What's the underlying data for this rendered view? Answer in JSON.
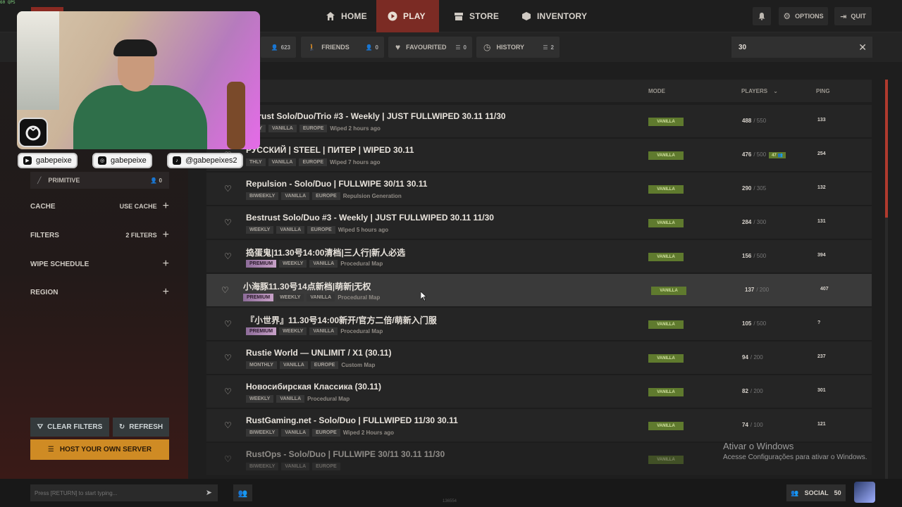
{
  "fps": "60 QPS",
  "nav": {
    "home": "HOME",
    "play": "PLAY",
    "store": "STORE",
    "inventory": "INVENTORY",
    "options": "OPTIONS",
    "quit": "QUIT"
  },
  "filter_tabs": [
    {
      "label": "",
      "count": "623"
    },
    {
      "label": "FRIENDS",
      "count": "0"
    },
    {
      "label": "FAVOURITED",
      "count": "0"
    },
    {
      "label": "HISTORY",
      "count": "2"
    }
  ],
  "search": {
    "value": "30"
  },
  "sidebar": {
    "primitive": {
      "label": "PRIMITIVE",
      "count": "0"
    },
    "cache": {
      "label": "CACHE",
      "action": "USE CACHE"
    },
    "filters": {
      "label": "FILTERS",
      "action": "2 FILTERS"
    },
    "wipe_schedule": {
      "label": "WIPE SCHEDULE"
    },
    "region": {
      "label": "REGION"
    },
    "clear_filters": "CLEAR FILTERS",
    "refresh": "REFRESH",
    "host_server": "HOST YOUR OWN SERVER"
  },
  "list_headers": {
    "name": "E",
    "mode": "MODE",
    "players": "PLAYERS",
    "ping": "PING"
  },
  "servers": [
    {
      "name": "estrust Solo/Duo/Trio #3 - Weekly | JUST FULLWIPED 30.11 11/30",
      "tags": [
        "EKLY",
        "VANILLA",
        "EUROPE"
      ],
      "desc": "Wiped 2 hours ago",
      "mode": "VANILLA",
      "players": "488",
      "max": "/ 550",
      "queue": "",
      "ping": "133"
    },
    {
      "name": "РУССКИЙ | STEEL | ПИТЕР | WIPED 30.11",
      "tags": [
        "THLY",
        "VANILLA",
        "EUROPE"
      ],
      "desc": "Wiped 7 hours ago",
      "mode": "VANILLA",
      "players": "476",
      "max": "/ 500",
      "queue": "47",
      "ping": "254"
    },
    {
      "name": "Repulsion - Solo/Duo | FULLWIPE 30/11 30.11",
      "tags": [
        "BIWEEKLY",
        "VANILLA",
        "EUROPE"
      ],
      "desc": "Repulsion Generation",
      "mode": "VANILLA",
      "players": "290",
      "max": "/ 305",
      "queue": "",
      "ping": "132"
    },
    {
      "name": "Bestrust Solo/Duo #3 - Weekly | JUST FULLWIPED 30.11 11/30",
      "tags": [
        "WEEKLY",
        "VANILLA",
        "EUROPE"
      ],
      "desc": "Wiped 5 hours ago",
      "mode": "VANILLA",
      "players": "284",
      "max": "/ 300",
      "queue": "",
      "ping": "131"
    },
    {
      "name": "捣蛋鬼|11.30号14:00清档|三人行|新人必选",
      "tags": [
        "PREMIUM",
        "WEEKLY",
        "VANILLA"
      ],
      "desc": "Procedural Map",
      "mode": "VANILLA",
      "players": "156",
      "max": "/ 500",
      "queue": "",
      "ping": "394"
    },
    {
      "name": "小海豚11.30号14点新档|萌新|无权",
      "tags": [
        "PREMIUM",
        "WEEKLY",
        "VANILLA"
      ],
      "desc": "Procedural Map",
      "mode": "VANILLA",
      "players": "137",
      "max": "/ 200",
      "queue": "",
      "ping": "407"
    },
    {
      "name": "『小世界』11.30号14:00新开/官方二倍/萌新入门服",
      "tags": [
        "PREMIUM",
        "WEEKLY",
        "VANILLA"
      ],
      "desc": "Procedural Map",
      "mode": "VANILLA",
      "players": "105",
      "max": "/ 500",
      "queue": "",
      "ping": "?"
    },
    {
      "name": "Rustie World — UNLIMIT / X1 (30.11)",
      "tags": [
        "MONTHLY",
        "VANILLA",
        "EUROPE"
      ],
      "desc": "Custom Map",
      "mode": "VANILLA",
      "players": "94",
      "max": "/ 200",
      "queue": "",
      "ping": "237"
    },
    {
      "name": "Новосибирская Классика (30.11)",
      "tags": [
        "WEEKLY",
        "VANILLA"
      ],
      "desc": "Procedural Map",
      "mode": "VANILLA",
      "players": "82",
      "max": "/ 200",
      "queue": "",
      "ping": "301"
    },
    {
      "name": "RustGaming.net - Solo/Duo | FULLWIPED 11/30 30.11",
      "tags": [
        "BIWEEKLY",
        "VANILLA",
        "EUROPE"
      ],
      "desc": "Wiped 2 Hours ago",
      "mode": "VANILLA",
      "players": "74",
      "max": "/ 100",
      "queue": "",
      "ping": "121"
    },
    {
      "name": "RustOps - Solo/Duo | FULLWIPE 30/11 30.11 11/30",
      "tags": [
        "BIWEEKLY",
        "VANILLA",
        "EUROPE"
      ],
      "desc": "",
      "mode": "VANILLA",
      "players": "",
      "max": "",
      "queue": "",
      "ping": ""
    }
  ],
  "chat": {
    "placeholder": "Press [RETURN] to start typing..."
  },
  "social": {
    "label": "SOCIAL",
    "count": "50"
  },
  "version": "136554",
  "webcam_socials": [
    "gabepeixe",
    "gabepeixe",
    "@gabepeixes2"
  ],
  "watermark": {
    "title": "Ativar o Windows",
    "subtitle": "Acesse Configurações para ativar o Windows."
  }
}
